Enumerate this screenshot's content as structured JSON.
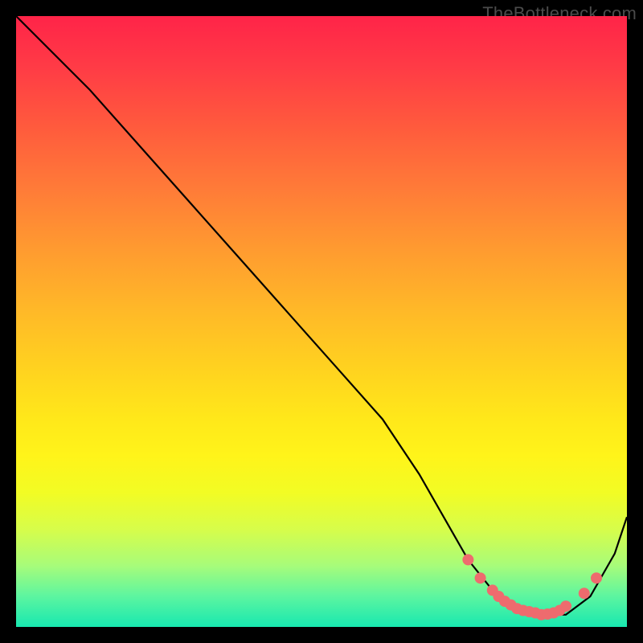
{
  "attribution": "TheBottleneck.com",
  "chart_data": {
    "type": "line",
    "title": "",
    "xlabel": "",
    "ylabel": "",
    "xlim": [
      0,
      100
    ],
    "ylim": [
      0,
      100
    ],
    "series": [
      {
        "name": "curve",
        "x": [
          0,
          6,
          12,
          20,
          28,
          36,
          44,
          52,
          60,
          66,
          70,
          74,
          78,
          82,
          86,
          90,
          94,
          98,
          100
        ],
        "y": [
          100,
          94,
          88,
          79,
          70,
          61,
          52,
          43,
          34,
          25,
          18,
          11,
          6,
          3,
          2,
          2,
          5,
          12,
          18
        ]
      }
    ],
    "markers": {
      "name": "highlight-points",
      "color": "#ee6b6e",
      "x": [
        74,
        76,
        78,
        79,
        80,
        81,
        82,
        83,
        84,
        85,
        86,
        87,
        88,
        89,
        90,
        93,
        95
      ],
      "y": [
        11,
        8,
        6,
        5,
        4.2,
        3.6,
        3,
        2.7,
        2.5,
        2.3,
        2,
        2.1,
        2.3,
        2.7,
        3.4,
        5.5,
        8
      ]
    },
    "background": {
      "type": "vertical-gradient",
      "stops": [
        {
          "pos": 0.0,
          "color": "#ff2448"
        },
        {
          "pos": 0.18,
          "color": "#ff5a3d"
        },
        {
          "pos": 0.38,
          "color": "#ff9a30"
        },
        {
          "pos": 0.58,
          "color": "#ffd31f"
        },
        {
          "pos": 0.78,
          "color": "#f2fc24"
        },
        {
          "pos": 0.95,
          "color": "#5cf5a0"
        },
        {
          "pos": 1.0,
          "color": "#18e8b0"
        }
      ]
    }
  }
}
